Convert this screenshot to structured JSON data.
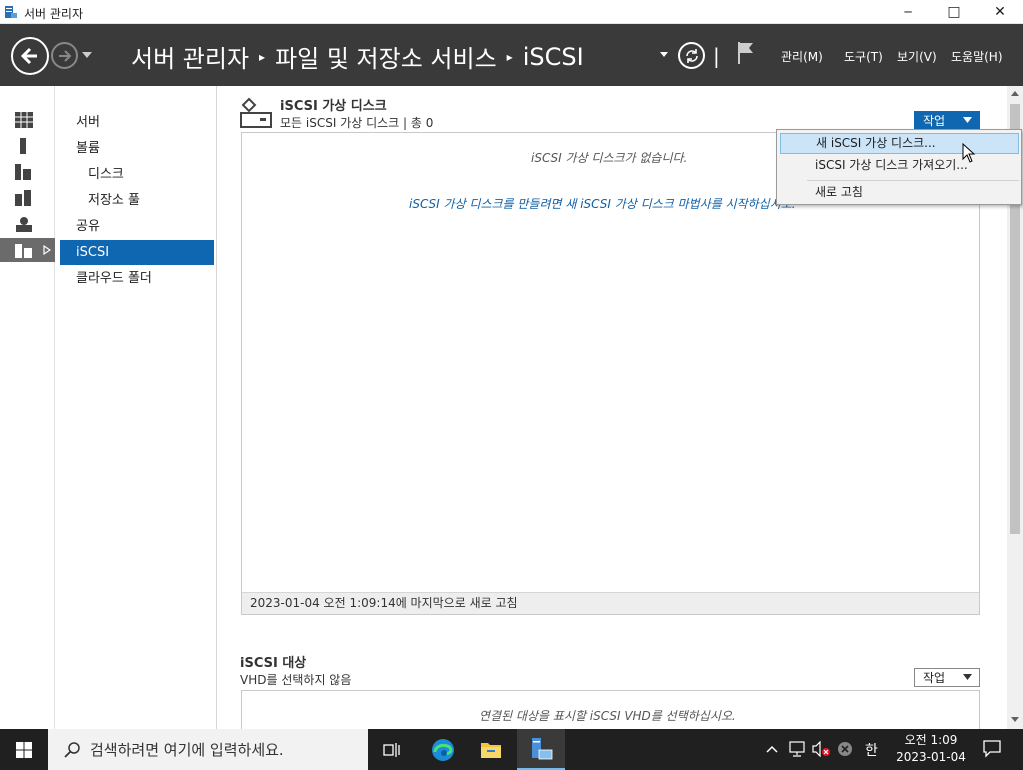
{
  "window": {
    "title": "서버 관리자",
    "minimize": "─",
    "maximize": "□",
    "close": "✕"
  },
  "header": {
    "breadcrumb": [
      "서버 관리자",
      "파일 및 저장소 서비스",
      "iSCSI"
    ],
    "menus": [
      "관리(M)",
      "도구(T)",
      "보기(V)",
      "도움말(H)"
    ]
  },
  "rail": {
    "icons": [
      "dashboard-icon",
      "server-icon",
      "all-servers-icon",
      "roles-icon",
      "storage-icon",
      "files-icon"
    ]
  },
  "nav": {
    "items": [
      {
        "label": "서버",
        "sub": false,
        "active": false
      },
      {
        "label": "볼륨",
        "sub": false,
        "active": false
      },
      {
        "label": "디스크",
        "sub": true,
        "active": false
      },
      {
        "label": "저장소 풀",
        "sub": true,
        "active": false
      },
      {
        "label": "공유",
        "sub": false,
        "active": false
      },
      {
        "label": "iSCSI",
        "sub": false,
        "active": true
      },
      {
        "label": "클라우드 폴더",
        "sub": false,
        "active": false
      }
    ]
  },
  "virtual_disks": {
    "title": "iSCSI 가상 디스크",
    "subtitle": "모든 iSCSI 가상 디스크 | 총 0",
    "tasks_label": "작업",
    "empty_message": "iSCSI 가상 디스크가 없습니다.",
    "empty_link": "iSCSI 가상 디스크를 만들려면 새 iSCSI 가상 디스크 마법사를 시작하십시오.",
    "footer": "2023-01-04 오전 1:09:14에 마지막으로 새로 고침"
  },
  "targets": {
    "title": "iSCSI 대상",
    "subtitle": "VHD를 선택하지 않음",
    "tasks_label": "작업",
    "empty_message": "연결된 대상을 표시할 iSCSI VHD를 선택하십시오."
  },
  "dropdown": {
    "items": [
      "새 iSCSI 가상 디스크...",
      "iSCSI 가상 디스크 가져오기...",
      "새로 고침"
    ]
  },
  "taskbar": {
    "search_placeholder": "검색하려면 여기에 입력하세요.",
    "ime": "한",
    "clock_time": "오전 1:09",
    "clock_date": "2023-01-04"
  },
  "colors": {
    "accent": "#0f67b1",
    "header_bg": "#3a3a3a",
    "highlight": "#cce4f7"
  }
}
